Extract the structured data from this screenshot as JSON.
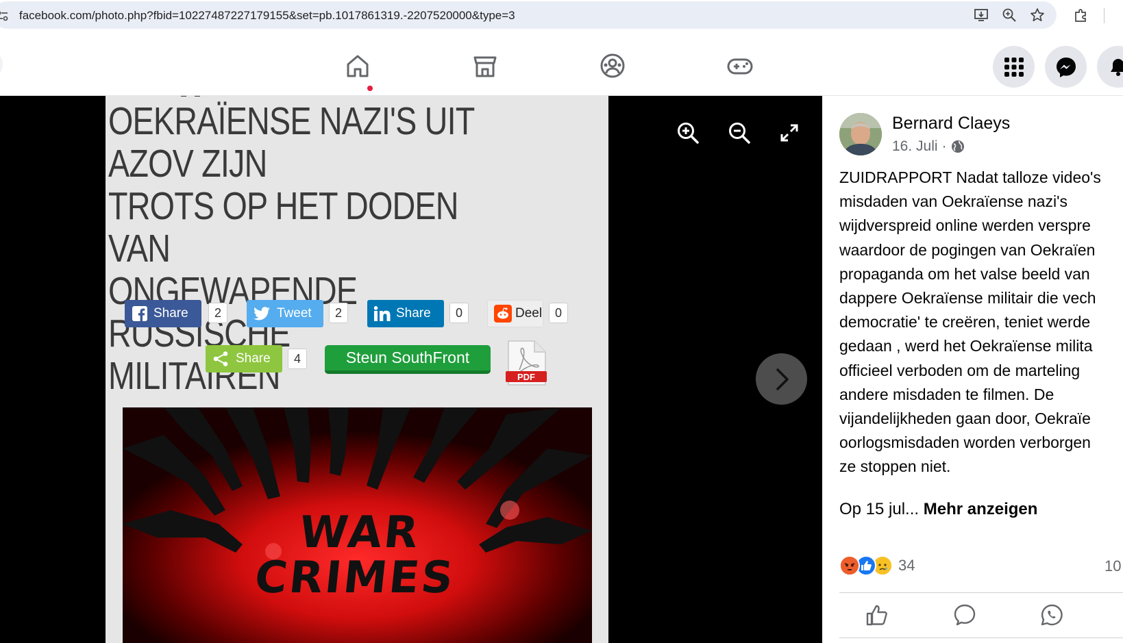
{
  "browser": {
    "url": "facebook.com/photo.php?fbid=10227487227179155&set=pb.1017861319.-2207520000&type=3"
  },
  "nav": {
    "tabs": [
      "home",
      "marketplace",
      "groups",
      "gaming"
    ],
    "notification_dot": true
  },
  "article": {
    "title_lines": [
      "OEKRAÏENSE NAZI'S UIT AZOV ZIJN",
      "TROTS OP HET DODEN VAN",
      "ONGEWAPENDE RUSSISCHE",
      "MILITAIREN"
    ],
    "share_buttons": [
      {
        "label": "Share",
        "count": "2",
        "network": "facebook",
        "color": "#3b5998"
      },
      {
        "label": "Tweet",
        "count": "2",
        "network": "twitter",
        "color": "#55acee"
      },
      {
        "label": "Share",
        "count": "0",
        "network": "linkedin",
        "color": "#0077b5"
      },
      {
        "label": "Deel",
        "count": "0",
        "network": "reddit",
        "color": "#eeeeee"
      },
      {
        "label": "Share",
        "count": "4",
        "network": "sharethis",
        "color": "#95d03a"
      }
    ],
    "support_button": "Steun SouthFront",
    "pdf_label": "PDF",
    "image_text": [
      "WAR",
      "CRIMES"
    ]
  },
  "post": {
    "author": "Bernard Claeys",
    "date": "16. Juli",
    "separator": "·",
    "text_lines": [
      "ZUIDRAPPORT Nadat talloze video's",
      "misdaden van Oekraïense nazi's",
      "wijdverspreid online werden verspre",
      "waardoor de pogingen van Oekraïen",
      "propaganda om het valse beeld van",
      "dappere Oekraïense militair die vech",
      "democratie' te creëren, teniet werde",
      "gedaan , werd het Oekraïense milita",
      "officieel verboden om de marteling",
      "andere misdaden te filmen. De",
      "vijandelijkheden gaan door, Oekraïe",
      "oorlogsmisdaden worden verborgen",
      "ze stoppen niet."
    ],
    "truncated": "Op 15 jul...",
    "more_label": "Mehr anzeigen",
    "reaction_count": "34",
    "comment_count": "10",
    "reactions": [
      "angry",
      "like",
      "sad"
    ]
  }
}
